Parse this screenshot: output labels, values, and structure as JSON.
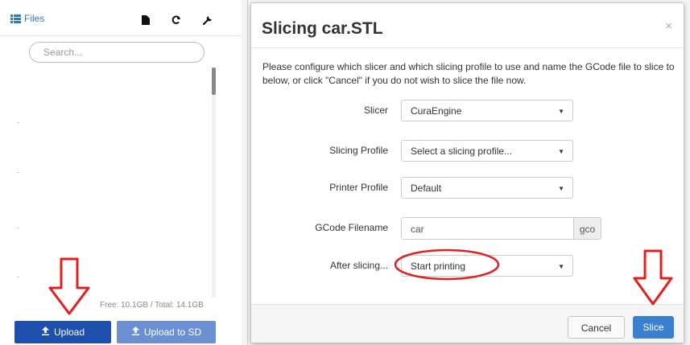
{
  "files_panel": {
    "title": "Files",
    "icons": [
      "list-icon",
      "file-icon",
      "refresh-icon",
      "wrench-icon"
    ],
    "search": {
      "placeholder": "Search..."
    },
    "storage_info": "Free: 10.1GB / Total: 14.1GB",
    "upload_button": "Upload",
    "upload_sd_button": "Upload to SD"
  },
  "dialog": {
    "title": "Slicing car.STL",
    "close": "×",
    "description": "Please configure which slicer and which slicing profile to use and name the GCode file to slice to below, or click \"Cancel\" if you do not wish to slice the file now.",
    "fields": {
      "slicer": {
        "label": "Slicer",
        "value": "CuraEngine"
      },
      "slicing_profile": {
        "label": "Slicing Profile",
        "value": "Select a slicing profile..."
      },
      "printer_profile": {
        "label": "Printer Profile",
        "value": "Default"
      },
      "gcode_filename": {
        "label": "GCode Filename",
        "value": "car",
        "suffix": "gco"
      },
      "after_slicing": {
        "label": "After slicing...",
        "value": "Start printing"
      }
    },
    "cancel_button": "Cancel",
    "slice_button": "Slice"
  },
  "colors": {
    "upload": "#1f4fae",
    "upload_sd": "#6b8fd3",
    "slice": "#3b7fd1",
    "annotation": "#e02020",
    "link": "#337ab7"
  }
}
